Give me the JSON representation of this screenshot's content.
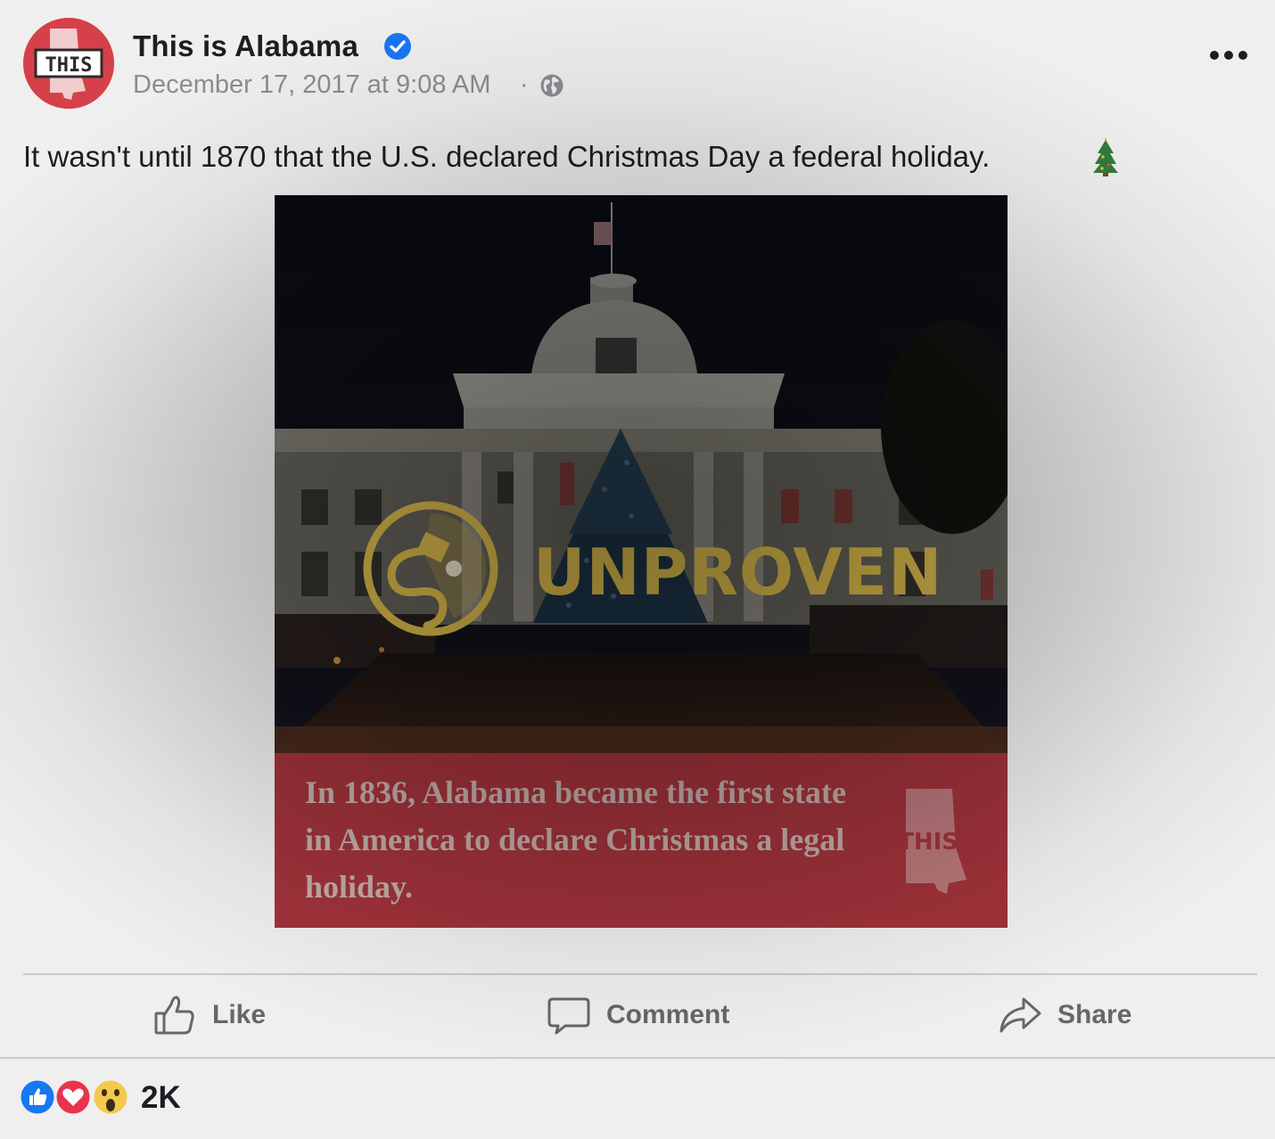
{
  "post": {
    "page_name": "This is Alabama",
    "timestamp": "December 17, 2017 at 9:08 AM",
    "separator": "·",
    "avatar_text": "THIS",
    "text": "It wasn't until 1870 that the U.S. declared Christmas Day a federal holiday.",
    "text_emoji": "christmas-tree-icon",
    "image": {
      "caption": "In 1836, Alabama became the first state in America to declare Christmas a legal holiday.",
      "caption_logo_text": "THIS.",
      "rating_label": "UNPROVEN",
      "rating_color": "#d9b94a",
      "caption_background": "#b73a43"
    }
  },
  "actions": {
    "like": "Like",
    "comment": "Comment",
    "share": "Share"
  },
  "reactions": {
    "icons": [
      "like-reaction-icon",
      "love-reaction-icon",
      "wow-reaction-icon"
    ],
    "count": "2K"
  },
  "colors": {
    "verified_badge": "#1877f2",
    "avatar_background": "#d6404a",
    "secondary_text": "#8a8d91"
  }
}
